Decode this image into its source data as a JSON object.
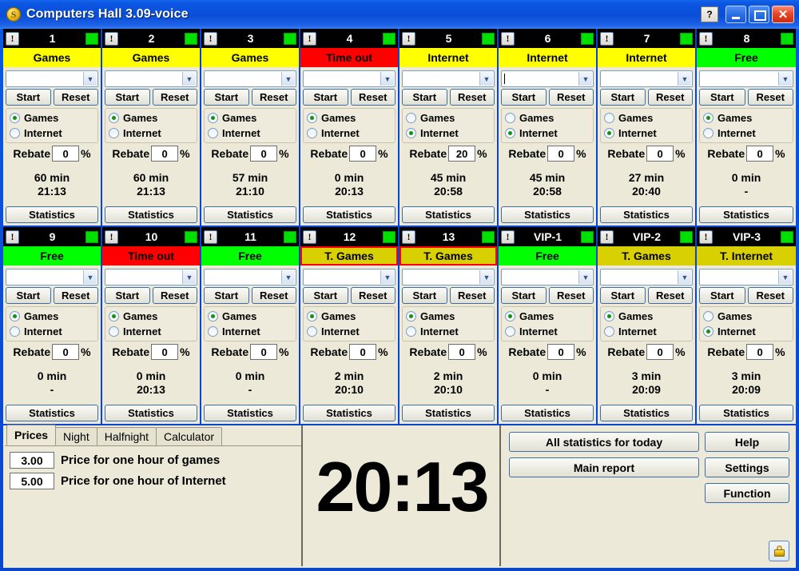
{
  "window": {
    "title": "Computers Hall 3.09-voice",
    "app_icon": "dollar-coin-icon",
    "buttons": {
      "help": "?",
      "minimize": "minimize-icon",
      "maximize": "maximize-icon",
      "close": "✕"
    }
  },
  "colors": {
    "title_blue": "#0a4fd8",
    "status_games": "#ffff00",
    "status_internet": "#ffff00",
    "status_free": "#00ff00",
    "status_timeout": "#ff0000",
    "status_tariff": "#d8d000",
    "alert_border": "#ff0000",
    "led_green": "#00e000",
    "panel_face": "#ece9d8"
  },
  "station_common": {
    "warn_icon": "exclamation-icon",
    "led_icon": "status-led-icon",
    "combo_placeholder": "",
    "start_label": "Start",
    "reset_label": "Reset",
    "radio_games": "Games",
    "radio_internet": "Internet",
    "rebate_label": "Rebate",
    "percent_label": "%",
    "statistics_label": "Statistics"
  },
  "stations": [
    {
      "number": "1",
      "status": "Games",
      "status_kind": "games",
      "alert": false,
      "focused": false,
      "mode": "games",
      "rebate": "0",
      "minutes": "60 min",
      "end_time": "21:13"
    },
    {
      "number": "2",
      "status": "Games",
      "status_kind": "games",
      "alert": false,
      "focused": false,
      "mode": "games",
      "rebate": "0",
      "minutes": "60 min",
      "end_time": "21:13"
    },
    {
      "number": "3",
      "status": "Games",
      "status_kind": "games",
      "alert": false,
      "focused": false,
      "mode": "games",
      "rebate": "0",
      "minutes": "57 min",
      "end_time": "21:10"
    },
    {
      "number": "4",
      "status": "Time out",
      "status_kind": "timeout",
      "alert": false,
      "focused": false,
      "mode": "games",
      "rebate": "0",
      "minutes": "0 min",
      "end_time": "20:13"
    },
    {
      "number": "5",
      "status": "Internet",
      "status_kind": "internet",
      "alert": false,
      "focused": false,
      "mode": "internet",
      "rebate": "20",
      "minutes": "45 min",
      "end_time": "20:58"
    },
    {
      "number": "6",
      "status": "Internet",
      "status_kind": "internet",
      "alert": false,
      "focused": true,
      "mode": "internet",
      "rebate": "0",
      "minutes": "45 min",
      "end_time": "20:58"
    },
    {
      "number": "7",
      "status": "Internet",
      "status_kind": "internet",
      "alert": false,
      "focused": false,
      "mode": "internet",
      "rebate": "0",
      "minutes": "27 min",
      "end_time": "20:40"
    },
    {
      "number": "8",
      "status": "Free",
      "status_kind": "free",
      "alert": false,
      "focused": false,
      "mode": "games",
      "rebate": "0",
      "minutes": "0 min",
      "end_time": "-"
    },
    {
      "number": "9",
      "status": "Free",
      "status_kind": "free",
      "alert": false,
      "focused": false,
      "mode": "games",
      "rebate": "0",
      "minutes": "0 min",
      "end_time": "-"
    },
    {
      "number": "10",
      "status": "Time out",
      "status_kind": "timeout",
      "alert": false,
      "focused": false,
      "mode": "games",
      "rebate": "0",
      "minutes": "0 min",
      "end_time": "20:13"
    },
    {
      "number": "11",
      "status": "Free",
      "status_kind": "free",
      "alert": false,
      "focused": false,
      "mode": "games",
      "rebate": "0",
      "minutes": "0 min",
      "end_time": "-"
    },
    {
      "number": "12",
      "status": "T. Games",
      "status_kind": "tariff",
      "alert": true,
      "focused": false,
      "mode": "games",
      "rebate": "0",
      "minutes": "2 min",
      "end_time": "20:10"
    },
    {
      "number": "13",
      "status": "T. Games",
      "status_kind": "tariff",
      "alert": true,
      "focused": false,
      "mode": "games",
      "rebate": "0",
      "minutes": "2 min",
      "end_time": "20:10"
    },
    {
      "number": "VIP-1",
      "status": "Free",
      "status_kind": "free",
      "alert": false,
      "focused": false,
      "mode": "games",
      "rebate": "0",
      "minutes": "0 min",
      "end_time": "-"
    },
    {
      "number": "VIP-2",
      "status": "T. Games",
      "status_kind": "tariff",
      "alert": false,
      "focused": false,
      "mode": "games",
      "rebate": "0",
      "minutes": "3 min",
      "end_time": "20:09"
    },
    {
      "number": "VIP-3",
      "status": "T. Internet",
      "status_kind": "tariff",
      "alert": false,
      "focused": false,
      "mode": "internet",
      "rebate": "0",
      "minutes": "3 min",
      "end_time": "20:09"
    }
  ],
  "tabs": {
    "items": [
      {
        "label": "Prices",
        "active": true
      },
      {
        "label": "Night",
        "active": false
      },
      {
        "label": "Halfnight",
        "active": false
      },
      {
        "label": "Calculator",
        "active": false
      }
    ],
    "prices": [
      {
        "value": "3.00",
        "label": "Price for one hour of games"
      },
      {
        "value": "5.00",
        "label": "Price for one hour of Internet"
      }
    ]
  },
  "clock": {
    "time": "20:13"
  },
  "actions": {
    "all_statistics": "All statistics for today",
    "main_report": "Main report",
    "help": "Help",
    "settings": "Settings",
    "function": "Function",
    "lock": "lock-icon"
  }
}
